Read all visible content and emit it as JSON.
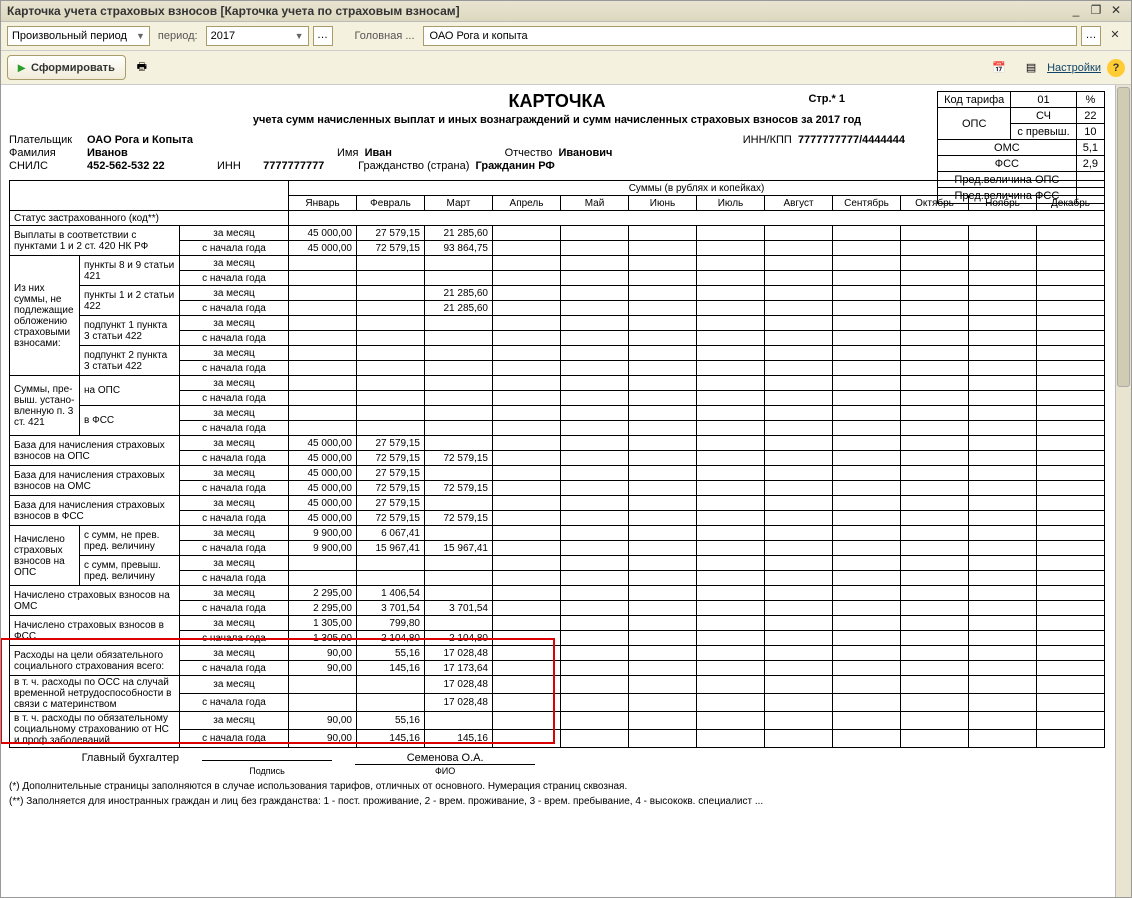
{
  "window": {
    "title": "Карточка учета страховых взносов [Карточка учета по страховым взносам]"
  },
  "toolbar": {
    "period_mode": "Произвольный период",
    "period_label": "период:",
    "period_value": "2017",
    "head_label": "Головная ...",
    "org": "ОАО Рога и копыта"
  },
  "toolbar2": {
    "form_btn": "Сформировать",
    "settings": "Настройки"
  },
  "doc": {
    "title": "КАРТОЧКА",
    "subtitle": "учета сумм начисленных выплат и иных вознаграждений и сумм начисленных страховых взносов за 2017 год",
    "page": "Стр.* 1"
  },
  "tariff": {
    "code_label": "Код тарифа",
    "code_val": "01",
    "pct": "%",
    "ops": "ОПС",
    "sch": "СЧ",
    "sch_val": "22",
    "sprev": "с превыш.",
    "sprev_val": "10",
    "oms": "ОМС",
    "oms_val": "5,1",
    "fss": "ФСС",
    "fss_val": "2,9",
    "lim_ops": "Пред.величина ОПС",
    "lim_fss": "Пред.величина ФСС"
  },
  "payer": {
    "payer_k": "Плательщик",
    "payer_v": "ОАО Рога и Копыта",
    "fam_k": "Фамилия",
    "fam_v": "Иванов",
    "name_k": "Имя",
    "name_v": "Иван",
    "patr_k": "Отчество",
    "patr_v": "Иванович",
    "snils_k": "СНИЛС",
    "snils_v": "452-562-532 22",
    "inn_k": "ИНН",
    "inn_v": "7777777777",
    "cit_k": "Гражданство (страна)",
    "cit_v": "Гражданин РФ",
    "innkpp_k": "ИНН/КПП",
    "innkpp_v": "7777777777/4444444"
  },
  "months_header": "Суммы (в рублях и копейках)",
  "months": [
    "Январь",
    "Февраль",
    "Март",
    "Апрель",
    "Май",
    "Июнь",
    "Июль",
    "Август",
    "Сентябрь",
    "Октябрь",
    "Ноябрь",
    "Декабрь"
  ],
  "period_m": "за месяц",
  "period_y": "с начала года",
  "rows": {
    "status": "Статус застрахованного (код**)",
    "payments": "Выплаты в соответствии с пунктами 1 и 2 ст. 420 НК РФ",
    "exempt_hdr": "Из них суммы, не подлежащие обложению страховыми взносами:",
    "ex1": "пункты 8 и 9 статьи 421",
    "ex2": "пункты 1 и 2 статьи 422",
    "ex3": "подпункт 1 пункта 3 статьи 422",
    "ex4": "подпункт 2 пункта 3 статьи 422",
    "over_hdr": "Суммы, пре-выш. устано-вленную п. 3 ст. 421",
    "over_ops": "на ОПС",
    "over_fss": "в ФСС",
    "base_ops": "База для начисления страховых взносов на ОПС",
    "base_oms": "База для начисления страховых взносов на ОМС",
    "base_fss": "База для начисления страховых взносов в ФСС",
    "acc_hdr": "Начислено страховых взносов на ОПС",
    "acc1": "с сумм, не прев. пред. величину",
    "acc2": "с сумм, превыш. пред. величину",
    "acc_oms": "Начислено страховых взносов на ОМС",
    "acc_fss": "Начислено страховых взносов в ФСС",
    "exp_all": "Расходы на цели обязательного социального страхования всего:",
    "exp_oss": "в т. ч. расходы по ОСС на случай временной нетрудоспособности в связи с материнством",
    "exp_ns": "в т. ч. расходы по обязательному социальному страхованию от НС и проф.заболеваний"
  },
  "data": {
    "payments_m": [
      "45 000,00",
      "27 579,15",
      "21 285,60"
    ],
    "payments_y": [
      "45 000,00",
      "72 579,15",
      "93 864,75"
    ],
    "ex2_m": [
      "",
      "",
      "21 285,60"
    ],
    "ex2_y": [
      "",
      "",
      "21 285,60"
    ],
    "base_ops_m": [
      "45 000,00",
      "27 579,15",
      ""
    ],
    "base_ops_y": [
      "45 000,00",
      "72 579,15",
      "72 579,15"
    ],
    "base_oms_m": [
      "45 000,00",
      "27 579,15",
      ""
    ],
    "base_oms_y": [
      "45 000,00",
      "72 579,15",
      "72 579,15"
    ],
    "base_fss_m": [
      "45 000,00",
      "27 579,15",
      ""
    ],
    "base_fss_y": [
      "45 000,00",
      "72 579,15",
      "72 579,15"
    ],
    "acc1_m": [
      "9 900,00",
      "6 067,41",
      ""
    ],
    "acc1_y": [
      "9 900,00",
      "15 967,41",
      "15 967,41"
    ],
    "acc_oms_m": [
      "2 295,00",
      "1 406,54",
      ""
    ],
    "acc_oms_y": [
      "2 295,00",
      "3 701,54",
      "3 701,54"
    ],
    "acc_fss_m": [
      "1 305,00",
      "799,80",
      ""
    ],
    "acc_fss_y": [
      "1 305,00",
      "2 104,80",
      "2 104,80"
    ],
    "exp_all_m": [
      "90,00",
      "55,16",
      "17 028,48"
    ],
    "exp_all_y": [
      "90,00",
      "145,16",
      "17 173,64"
    ],
    "exp_oss_m": [
      "",
      "",
      "17 028,48"
    ],
    "exp_oss_y": [
      "",
      "",
      "17 028,48"
    ],
    "exp_ns_m": [
      "90,00",
      "55,16",
      ""
    ],
    "exp_ns_y": [
      "90,00",
      "145,16",
      "145,16"
    ]
  },
  "footer": {
    "chief": "Главный бухгалтер",
    "sign": "Подпись",
    "fio": "ФИО",
    "name": "Семенова О.А.",
    "note1": "(*) Дополнительные страницы заполняются в случае использования тарифов, отличных от основного. Нумерация страниц сквозная.",
    "note2": "(**) Заполняется для иностранных граждан и лиц без гражданства: 1 - пост. проживание, 2 - врем. проживание, 3 - врем. пребывание, 4 - высококв. специалист ..."
  }
}
